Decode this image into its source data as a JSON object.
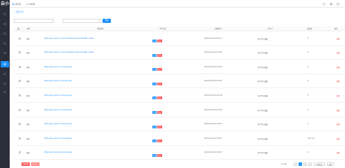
{
  "brand": {
    "logo_text": "云小"
  },
  "sidebar": {
    "items": [
      {
        "label": "",
        "icon": "monitor-icon"
      },
      {
        "label": "",
        "icon": "grid-icon"
      },
      {
        "label": "",
        "icon": "doc-icon"
      },
      {
        "label": "",
        "icon": "link-icon"
      },
      {
        "label": "",
        "icon": "chart-icon"
      },
      {
        "label": "",
        "icon": "user-icon"
      },
      {
        "label": "插件",
        "icon": "plug-icon",
        "active": true
      },
      {
        "label": "",
        "icon": "box-icon"
      },
      {
        "label": "",
        "icon": "cog-icon"
      },
      {
        "label": "",
        "icon": "tag-icon"
      }
    ]
  },
  "topbar": {
    "tabs": [
      "API列表",
      "API详情"
    ]
  },
  "subbar": {
    "back_label": "任务记录"
  },
  "filters": {
    "input1_placeholder": "",
    "input2_placeholder": "",
    "button_label": "查询"
  },
  "table": {
    "headers": [
      "",
      "类型",
      "链接地址",
      "API 信息",
      "创建时间",
      "用户IP",
      "返回值",
      "操作"
    ],
    "rows": [
      {
        "type": "文本",
        "url": "https://api.xxxxxx.com/v1/chat?key=ab12cd34ef56...0c1a2",
        "tags": [
          "正常",
          "成功"
        ],
        "time": "2024-06-18 14:32:17",
        "ip": "用户IP已隐藏",
        "ret": "0",
        "act": "删除"
      },
      {
        "type": "文本",
        "url": "https://api.xxxxxx.com/v1/chat?key=ab12cd34ef56...0c1a2",
        "tags": [
          "正常",
          "成功"
        ],
        "time": "2024-06-18 14:32:25",
        "ip": "用户IP已隐藏",
        "ret": "0",
        "act": "删除"
      },
      {
        "type": "文本",
        "url": "https://api.xxxxxx.com/v1/image",
        "tags": [
          "正常",
          "成功"
        ],
        "time": "2024-06-18 14:32:40",
        "ip": "用户IP已隐藏",
        "ret": "0",
        "act": "删除"
      },
      {
        "type": "文本",
        "url": "https://api.xxxxxx.com/v1/image",
        "tags": [
          "正常",
          "成功"
        ],
        "time": "2024-06-18 14:33:02",
        "ip": "用户IP已隐藏",
        "ret": "0",
        "act": "删除"
      },
      {
        "type": "文本",
        "url": "https://api.xxxxxx.com/v1/image",
        "tags": [
          "正常",
          "成功"
        ],
        "time": "2024-06-18 14:33:18",
        "ip": "用户IP已隐藏",
        "ret": "0",
        "act": "删除"
      },
      {
        "type": "文本",
        "url": "https://api.xxxxxx.com/v1/image",
        "tags": [
          "正常",
          "成功"
        ],
        "time": "2024-06-18 14:33:36",
        "ip": "用户IP已隐藏",
        "ret": "0",
        "act": "删除"
      },
      {
        "type": "文本",
        "url": "https://api.xxxxxx.com/v1/image",
        "tags": [
          "正常",
          "成功"
        ],
        "time": "2024-06-18 14:33:51",
        "ip": "用户IP已隐藏",
        "ret": "0",
        "act": "删除"
      },
      {
        "type": "文本",
        "url": "https://api.xxxxxx.com/v1/image",
        "tags": [
          "正常",
          "成功"
        ],
        "time": "2024-06-18 14:34:07",
        "ip": "用户IP已隐藏",
        "ret": "128 / 13",
        "act": "删除"
      },
      {
        "type": "文本",
        "url": "https://api.xxxxxx.com/v1/image",
        "tags": [
          "正常",
          "成功"
        ],
        "time": "2024-06-18 14:34:22",
        "ip": "用户IP已隐藏",
        "ret": "0",
        "act": "删除"
      }
    ]
  },
  "footer": {
    "batch_delete": "批量删除",
    "batch_export": "批量导出",
    "pager_info": "共 9 条",
    "pages": [
      "<",
      "1",
      "2",
      ">"
    ],
    "page_size": "10条/页",
    "goto_label": "前往"
  },
  "colors": {
    "primary": "#1890ff",
    "danger": "#ff4d4f",
    "sidebar": "#2b2f3a"
  }
}
